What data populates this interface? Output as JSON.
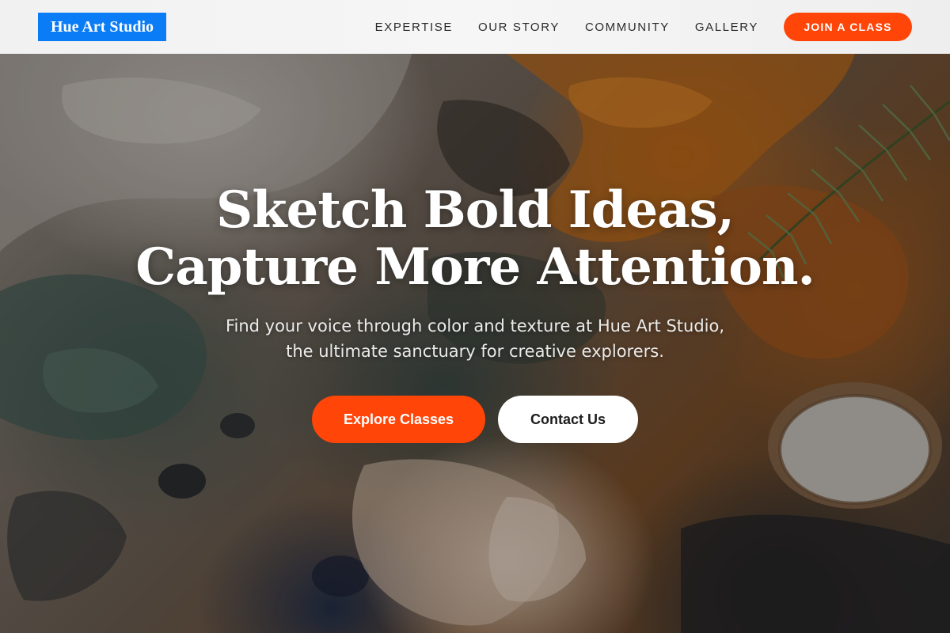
{
  "header": {
    "logo_text": "Hue Art Studio",
    "nav": [
      {
        "label": "EXPERTISE"
      },
      {
        "label": "OUR STORY"
      },
      {
        "label": "COMMUNITY"
      },
      {
        "label": "GALLERY"
      }
    ],
    "cta_label": "JOIN A CLASS"
  },
  "hero": {
    "headline_line1": "Sketch Bold Ideas,",
    "headline_line2": "Capture More Attention.",
    "subtitle_line1": "Find your voice through color and texture at Hue Art Studio,",
    "subtitle_line2": "the ultimate sanctuary for creative explorers.",
    "primary_button": "Explore Classes",
    "secondary_button": "Contact Us",
    "background_image": "abstract-oil-paint-texture"
  },
  "colors": {
    "accent": "#ff4508",
    "logo_bg": "#0a7cf5",
    "header_bg": "#f3f3f3",
    "text_light": "#ffffff",
    "nav_text": "#2b2b2b"
  }
}
